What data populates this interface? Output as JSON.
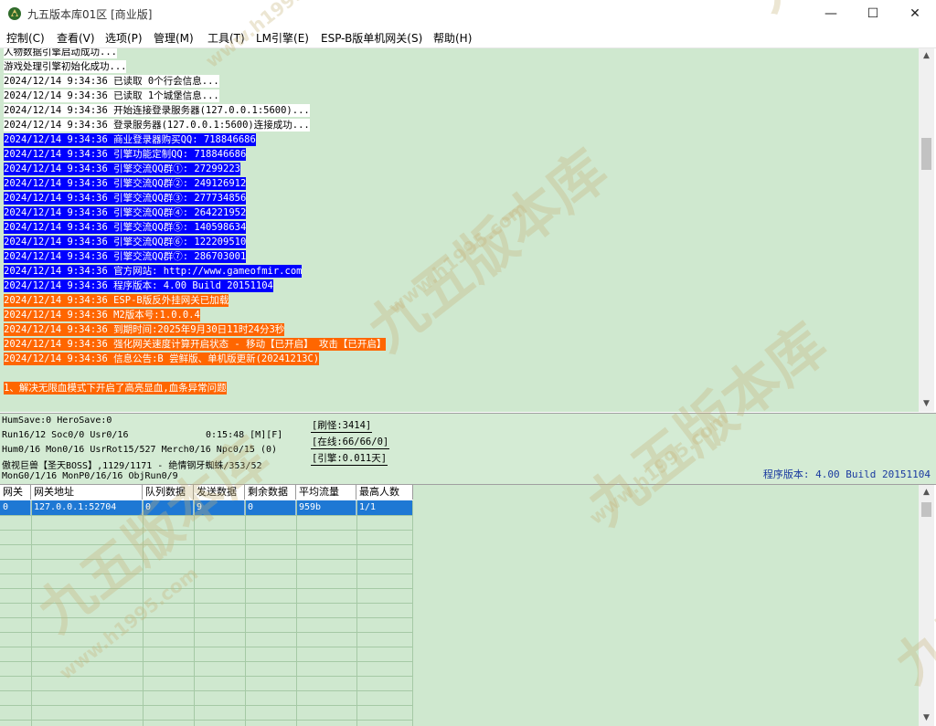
{
  "window": {
    "title": "九五版本库01区 [商业版]",
    "controls": {
      "minimize": "—",
      "maximize": "☐",
      "close": "✕"
    }
  },
  "menu": [
    {
      "label": "控制(C)"
    },
    {
      "label": "查看(V)"
    },
    {
      "label": "选项(P)"
    },
    {
      "label": "管理(M)"
    },
    {
      "label": "工具(T)"
    },
    {
      "label": "LM引擎(E)"
    },
    {
      "label": "ESP-B版单机网关(S)"
    },
    {
      "label": "帮助(H)"
    }
  ],
  "colors": {
    "log_background": "#cfe8cf",
    "highlight_white": "#ffffff",
    "highlight_blue": "#0000ff",
    "highlight_orange": "#ff6600",
    "selection_blue": "#1e78d4",
    "version_text": "#1a3aa0"
  },
  "log": [
    {
      "text": "人物数据引擎启动成功...",
      "style": "white"
    },
    {
      "text": "游戏处理引擎初始化成功...",
      "style": "white"
    },
    {
      "text": "2024/12/14 9:34:36 已读取 0个行会信息...",
      "style": "white"
    },
    {
      "text": "2024/12/14 9:34:36 已读取 1个城堡信息...",
      "style": "white"
    },
    {
      "text": "2024/12/14 9:34:36 开始连接登录服务器(127.0.0.1:5600)...",
      "style": "white"
    },
    {
      "text": "2024/12/14 9:34:36 登录服务器(127.0.0.1:5600)连接成功...",
      "style": "white"
    },
    {
      "text": "2024/12/14 9:34:36 商业登录器购买QQ: 718846686",
      "style": "blue"
    },
    {
      "text": "2024/12/14 9:34:36 引擎功能定制QQ: 718846686",
      "style": "blue"
    },
    {
      "text": "2024/12/14 9:34:36 引擎交流QQ群①: 27299223",
      "style": "blue"
    },
    {
      "text": "2024/12/14 9:34:36 引擎交流QQ群②: 249126912",
      "style": "blue"
    },
    {
      "text": "2024/12/14 9:34:36 引擎交流QQ群③: 277734856",
      "style": "blue"
    },
    {
      "text": "2024/12/14 9:34:36 引擎交流QQ群④: 264221952",
      "style": "blue"
    },
    {
      "text": "2024/12/14 9:34:36 引擎交流QQ群⑤: 140598634",
      "style": "blue"
    },
    {
      "text": "2024/12/14 9:34:36 引擎交流QQ群⑥: 122209510",
      "style": "blue"
    },
    {
      "text": "2024/12/14 9:34:36 引擎交流QQ群⑦: 286703001",
      "style": "blue"
    },
    {
      "text": "2024/12/14 9:34:36 官方网站: http://www.gameofmir.com",
      "style": "blue"
    },
    {
      "text": "2024/12/14 9:34:36 程序版本: 4.00 Build 20151104",
      "style": "blue"
    },
    {
      "text": "2024/12/14 9:34:36 ESP-B版反外挂网关已加载",
      "style": "orange"
    },
    {
      "text": "2024/12/14 9:34:36 M2版本号:1.0.0.4",
      "style": "orange"
    },
    {
      "text": "2024/12/14 9:34:36 到期时间:2025年9月30日11时24分3秒",
      "style": "orange"
    },
    {
      "text": "2024/12/14 9:34:36 强化网关速度计算开启状态 - 移动【已开启】 攻击【已开启】",
      "style": "orange"
    },
    {
      "text": "2024/12/14 9:34:36 信息公告:B 尝鲜版、单机版更新(20241213C)",
      "style": "orange"
    },
    {
      "text": "",
      "style": "none"
    },
    {
      "text": "1、解决无限血模式下开启了高亮显血,血条异常问题",
      "style": "orange"
    }
  ],
  "status": {
    "line1": "HumSave:0 HeroSave:0",
    "line2a": "Run16/12 Soc0/0 Usr0/16",
    "line2b": "0:15:48 [M][F]",
    "line3": "Hum0/16 Mon0/16 UsrRot15/527 Merch0/16 Npc0/15 (0)",
    "line4": "傲视巨兽【圣天BOSS】,1129/1171 - 绝情钢牙蜘蛛/353/52",
    "line5": "MonG0/1/16 MonP0/16/16 ObjRun0/9",
    "refresh_monster": "[刷怪:3414]",
    "online": "[在线:66/66/0]",
    "engine": "[引擎:0.011天]",
    "program_version": "程序版本: 4.00 Build 20151104"
  },
  "gateway": {
    "columns": [
      "网关",
      "网关地址",
      "队列数据",
      "发送数据",
      "剩余数据",
      "平均流量",
      "最高人数"
    ],
    "rows": [
      [
        "0",
        "127.0.0.1:52704",
        "0",
        "9",
        "0",
        "959b",
        "1/1"
      ]
    ]
  },
  "watermark": {
    "text": "九五版本库",
    "url": "www.h1995.com"
  }
}
